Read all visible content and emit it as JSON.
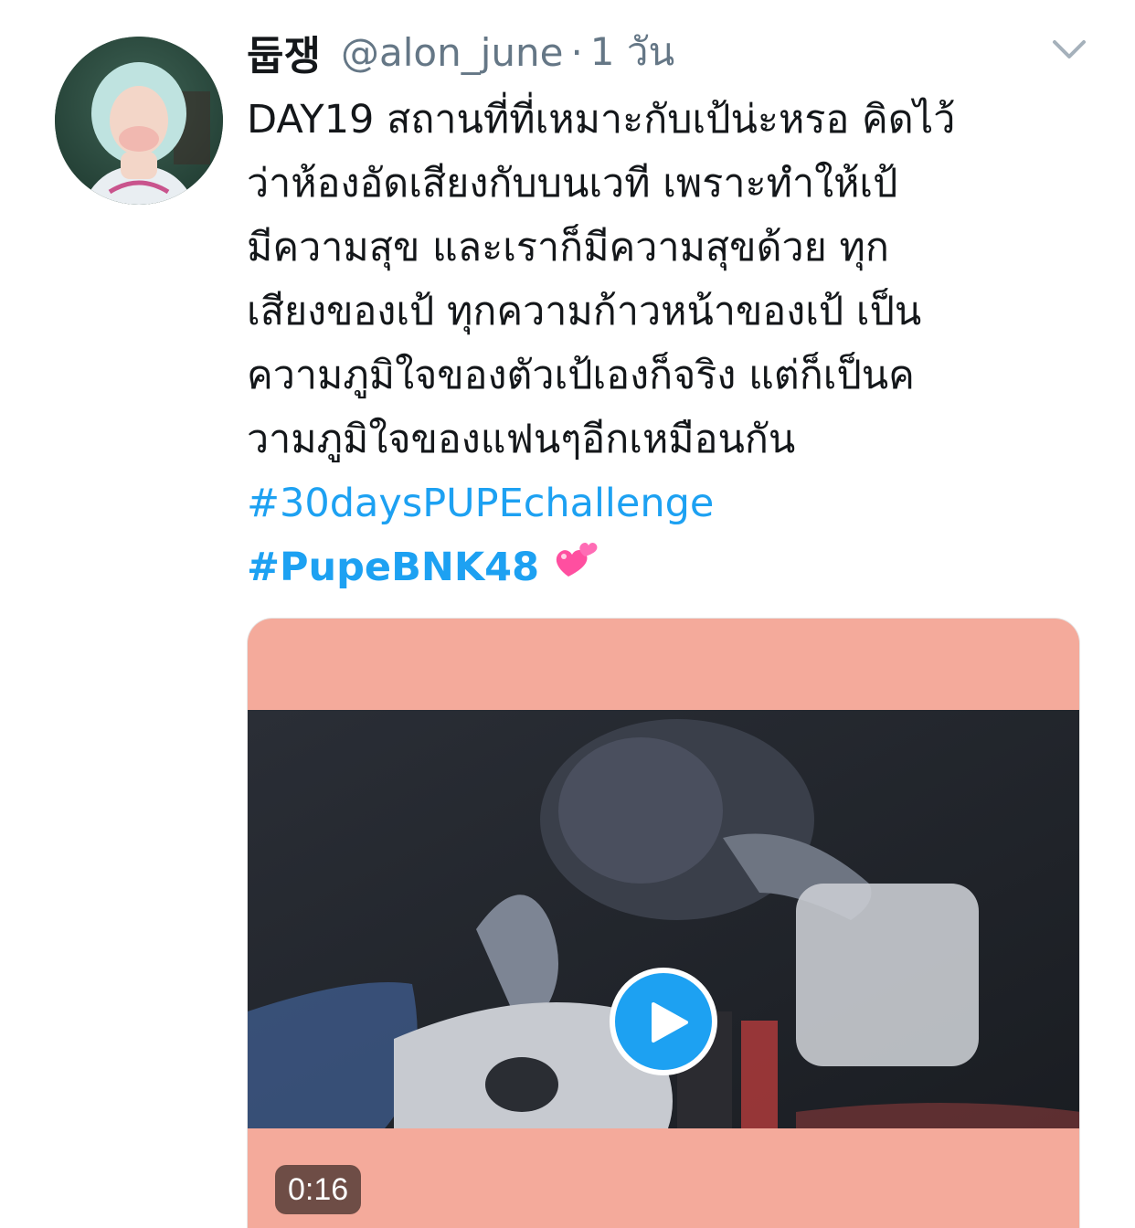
{
  "tweet": {
    "display_name": "둡쟁",
    "handle": "@alon_june",
    "separator": "·",
    "time": "1 วัน",
    "text_lines": [
      "DAY19 สถานที่ที่เหมาะกับเป้น่ะหรอ คิดไว้",
      "ว่าห้องอัดเสียงกับบนเวที เพราะทำให้เป้",
      "มีความสุข และเราก็มีความสุขด้วย ทุก",
      "เสียงของเป้ ทุกความก้าวหน้าของเป้ เป็น",
      "ความภูมิใจของตัวเป้เองก็จริง แต่ก็เป็นค",
      "วามภูมิใจของแฟนๆอีกเหมือนกัน"
    ],
    "hashtags": [
      "#30daysPUPEchallenge",
      "#PupeBNK48"
    ],
    "emoji": "two-hearts"
  },
  "media": {
    "duration": "0:16"
  },
  "colors": {
    "link": "#1da1f2",
    "secondary_text": "#657786",
    "media_background": "#f4aa9b"
  },
  "icons": {
    "caret": "chevron-down-icon",
    "play": "play-icon",
    "emoji": "two-hearts-icon"
  }
}
